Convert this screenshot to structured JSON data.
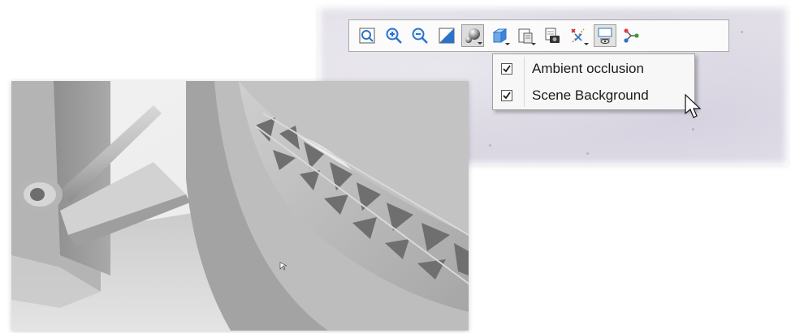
{
  "toolbar": {
    "buttons": [
      {
        "id": "zoom-fit",
        "icon": "zoom-window-icon"
      },
      {
        "id": "zoom-in",
        "icon": "zoom-in-icon"
      },
      {
        "id": "zoom-out",
        "icon": "zoom-out-icon"
      },
      {
        "id": "view-orient",
        "icon": "section-plane-icon"
      },
      {
        "id": "visual-style",
        "icon": "shading-sphere-icon",
        "state": "active",
        "has_dropdown": true
      },
      {
        "id": "display-style",
        "icon": "cube-icon",
        "has_dropdown": true
      },
      {
        "id": "appearance",
        "icon": "document-stack-icon",
        "has_dropdown": true
      },
      {
        "id": "camera",
        "icon": "camera-icon"
      },
      {
        "id": "hide-show",
        "icon": "axis-cross-icon",
        "has_dropdown": true
      },
      {
        "id": "scene",
        "icon": "scene-display-icon",
        "state": "pressed"
      },
      {
        "id": "connections",
        "icon": "branch-nodes-icon"
      }
    ]
  },
  "menu": {
    "items": [
      {
        "label": "Ambient occlusion",
        "checked": true
      },
      {
        "label": "Scene Background",
        "checked": true
      }
    ]
  },
  "colors": {
    "toolbar_bg": "#fbfbfc",
    "menu_bg": "#f7f7f7",
    "model_gray": "#b9b9b9",
    "accent_blue": "#2a73c9"
  }
}
